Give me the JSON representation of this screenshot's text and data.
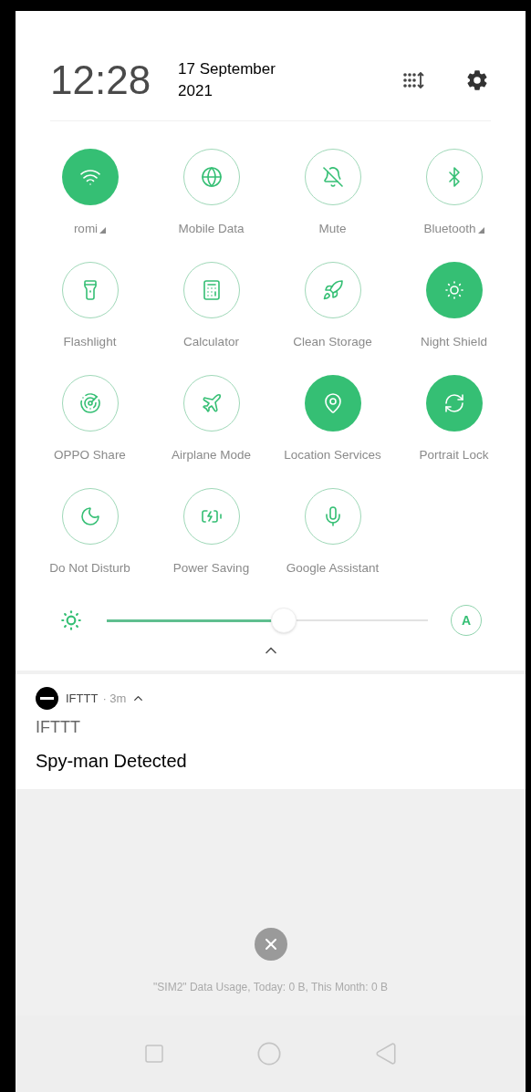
{
  "header": {
    "time": "12:28",
    "date": "17 September 2021"
  },
  "tiles": [
    {
      "label": "romi",
      "on": true,
      "has_menu": true
    },
    {
      "label": "Mobile Data",
      "on": false,
      "has_menu": false
    },
    {
      "label": "Mute",
      "on": false,
      "has_menu": false
    },
    {
      "label": "Bluetooth",
      "on": false,
      "has_menu": true
    },
    {
      "label": "Flashlight",
      "on": false,
      "has_menu": false
    },
    {
      "label": "Calculator",
      "on": false,
      "has_menu": false
    },
    {
      "label": "Clean Storage",
      "on": false,
      "has_menu": false
    },
    {
      "label": "Night Shield",
      "on": true,
      "has_menu": false
    },
    {
      "label": "OPPO Share",
      "on": false,
      "has_menu": false
    },
    {
      "label": "Airplane Mode",
      "on": false,
      "has_menu": false
    },
    {
      "label": "Location Services",
      "on": true,
      "has_menu": false
    },
    {
      "label": "Portrait Lock",
      "on": true,
      "has_menu": false
    },
    {
      "label": "Do Not Disturb",
      "on": false,
      "has_menu": false
    },
    {
      "label": "Power Saving",
      "on": false,
      "has_menu": false
    },
    {
      "label": "Google Assistant",
      "on": false,
      "has_menu": false
    }
  ],
  "brightness": {
    "level": 0.55,
    "auto_label": "A"
  },
  "notification": {
    "app": "IFTTT",
    "separator": "·",
    "time": "3m",
    "expanded": true,
    "title": "IFTTT",
    "text": "Spy-man Detected"
  },
  "data_usage": "\"SIM2\" Data Usage, Today: 0 B, This Month: 0 B"
}
